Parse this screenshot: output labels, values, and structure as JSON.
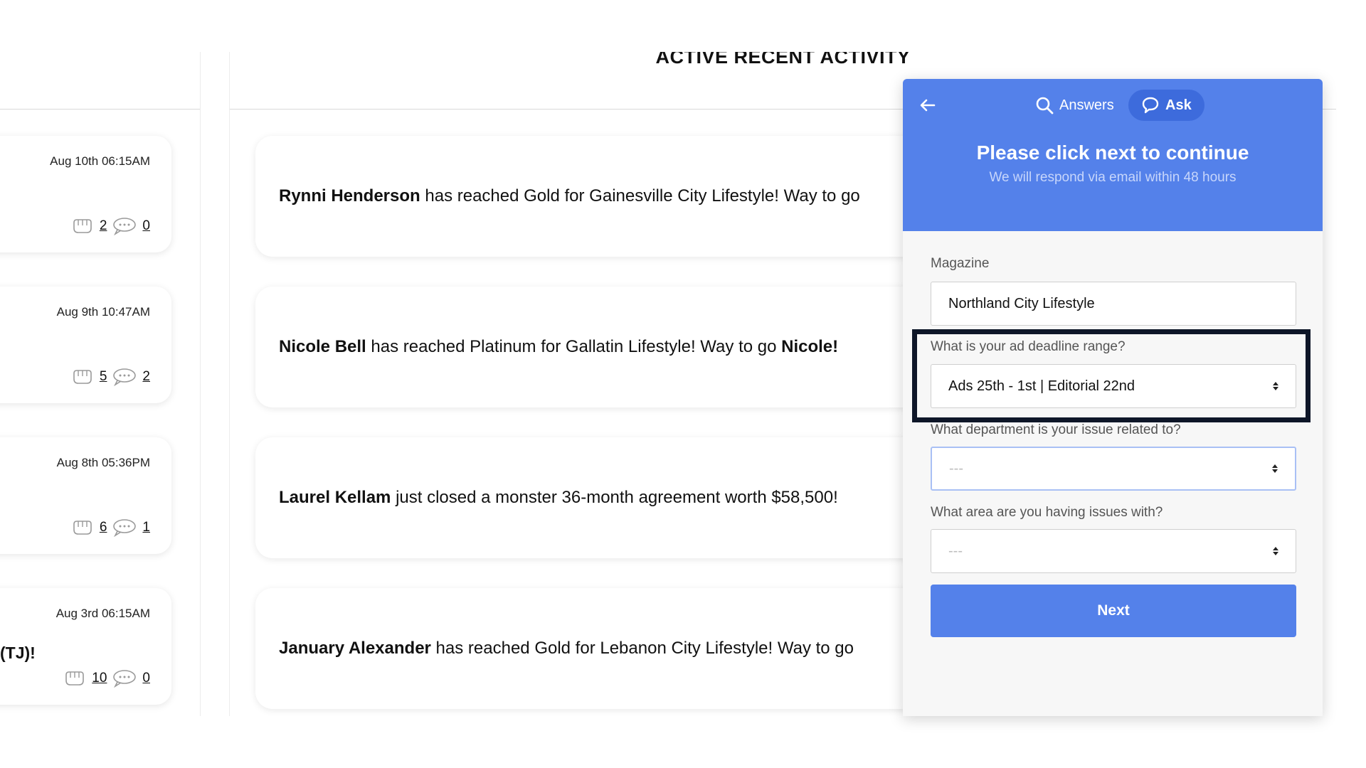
{
  "left_cards": [
    {
      "date": "Aug 10th 06:15AM",
      "text": "",
      "likes": "2",
      "comments": "0"
    },
    {
      "date": "Aug 9th 10:47AM",
      "text": "",
      "likes": "5",
      "comments": "2"
    },
    {
      "date": "Aug 8th 05:36PM",
      "text": "",
      "likes": "6",
      "comments": "1"
    },
    {
      "date": "Aug 3rd 06:15AM",
      "text": "(TJ)!",
      "likes": "10",
      "comments": "0"
    }
  ],
  "main": {
    "title": "ACTIVE RECENT ACTIVITY",
    "items": [
      {
        "name": "Rynni Henderson",
        "text": " has reached Gold for Gainesville City Lifestyle! Way to go",
        "tail_bold": ""
      },
      {
        "name": "Nicole Bell",
        "text": " has reached Platinum for Gallatin Lifestyle! Way to go ",
        "tail_bold": "Nicole!"
      },
      {
        "name": "Laurel Kellam",
        "text": " just closed a monster 36-month agreement worth $58,500!",
        "tail_bold": ""
      },
      {
        "name": "January Alexander",
        "text": " has reached Gold for Lebanon City Lifestyle! Way to go",
        "tail_bold": ""
      }
    ]
  },
  "widget": {
    "tabs": {
      "answers": "Answers",
      "ask": "Ask"
    },
    "title": "Please click next to continue",
    "subtitle": "We will respond via email within 48 hours",
    "magazine_label": "Magazine",
    "magazine_value": "Northland City Lifestyle",
    "deadline_label": "What is your ad deadline range?",
    "deadline_value": "Ads 25th - 1st | Editorial 22nd",
    "department_label": "What department is your issue related to?",
    "department_value": "---",
    "area_label": "What area are you having issues with?",
    "area_value": "---",
    "next_label": "Next",
    "accent_color": "#5481ea"
  }
}
